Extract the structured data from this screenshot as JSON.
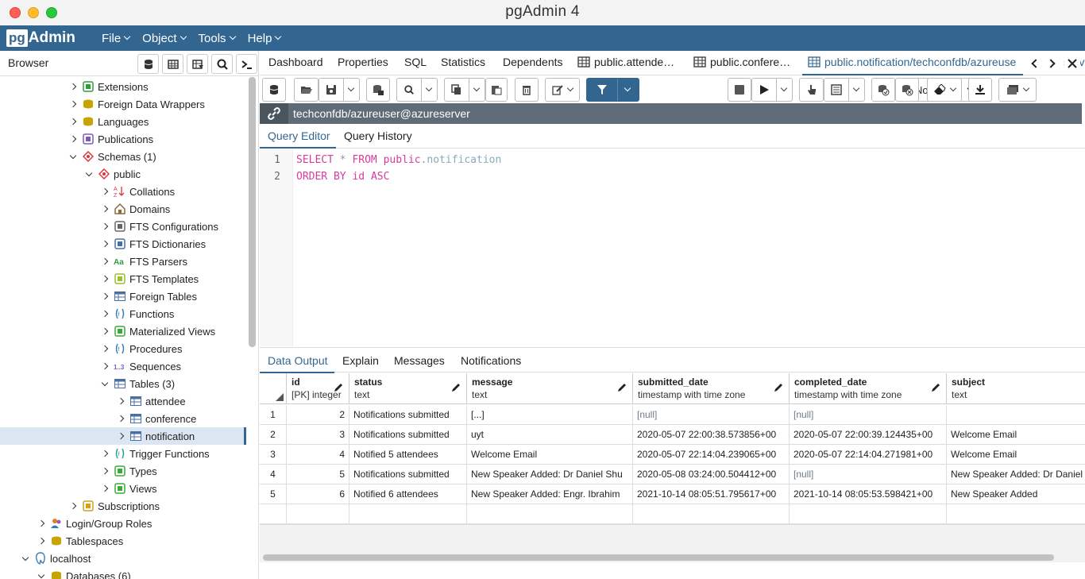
{
  "window": {
    "title": "pgAdmin 4"
  },
  "app": {
    "logo_pg": "pg",
    "logo_admin": "Admin"
  },
  "menubar": {
    "items": [
      "File",
      "Object",
      "Tools",
      "Help"
    ]
  },
  "browser": {
    "title": "Browser",
    "tree": [
      {
        "label": "Extensions",
        "indent": 1,
        "icon": "extensions-icon"
      },
      {
        "label": "Foreign Data Wrappers",
        "indent": 1,
        "icon": "foreign-data-wrapper-icon"
      },
      {
        "label": "Languages",
        "indent": 1,
        "icon": "languages-icon"
      },
      {
        "label": "Publications",
        "indent": 1,
        "icon": "publications-icon"
      },
      {
        "label": "Schemas (1)",
        "indent": 1,
        "icon": "schemas-icon",
        "open": true
      },
      {
        "label": "public",
        "indent": 2,
        "icon": "schema-icon",
        "open": true
      },
      {
        "label": "Collations",
        "indent": 3,
        "icon": "collations-icon"
      },
      {
        "label": "Domains",
        "indent": 3,
        "icon": "domains-icon"
      },
      {
        "label": "FTS Configurations",
        "indent": 3,
        "icon": "fts-config-icon"
      },
      {
        "label": "FTS Dictionaries",
        "indent": 3,
        "icon": "fts-dictionary-icon"
      },
      {
        "label": "FTS Parsers",
        "indent": 3,
        "icon": "fts-parser-icon"
      },
      {
        "label": "FTS Templates",
        "indent": 3,
        "icon": "fts-template-icon"
      },
      {
        "label": "Foreign Tables",
        "indent": 3,
        "icon": "foreign-table-icon"
      },
      {
        "label": "Functions",
        "indent": 3,
        "icon": "functions-icon"
      },
      {
        "label": "Materialized Views",
        "indent": 3,
        "icon": "materialized-view-icon"
      },
      {
        "label": "Procedures",
        "indent": 3,
        "icon": "procedures-icon"
      },
      {
        "label": "Sequences",
        "indent": 3,
        "icon": "sequences-icon"
      },
      {
        "label": "Tables (3)",
        "indent": 3,
        "icon": "tables-icon",
        "open": true
      },
      {
        "label": "attendee",
        "indent": 4,
        "icon": "table-icon"
      },
      {
        "label": "conference",
        "indent": 4,
        "icon": "table-icon"
      },
      {
        "label": "notification",
        "indent": 4,
        "icon": "table-icon",
        "selected": true
      },
      {
        "label": "Trigger Functions",
        "indent": 3,
        "icon": "trigger-function-icon"
      },
      {
        "label": "Types",
        "indent": 3,
        "icon": "types-icon"
      },
      {
        "label": "Views",
        "indent": 3,
        "icon": "views-icon"
      },
      {
        "label": "Subscriptions",
        "indent": 1,
        "icon": "subscriptions-icon"
      },
      {
        "label": "Login/Group Roles",
        "indent": -1,
        "icon": "login-roles-icon"
      },
      {
        "label": "Tablespaces",
        "indent": -1,
        "icon": "tablespaces-icon"
      },
      {
        "label": "localhost",
        "indent": -2,
        "icon": "server-icon",
        "open": true
      },
      {
        "label": "Databases (6)",
        "indent": -1,
        "icon": "databases-icon",
        "open": true
      }
    ]
  },
  "tabs": [
    {
      "label": "Dashboard"
    },
    {
      "label": "Properties"
    },
    {
      "label": "SQL"
    },
    {
      "label": "Statistics"
    },
    {
      "label": "Dependents"
    },
    {
      "label": "public.attende…"
    },
    {
      "label": "public.confere…"
    },
    {
      "label": "public.notification/techconfdb/azureuse"
    },
    {
      "label": "serv"
    }
  ],
  "toolbar": {
    "limit_value": "No limit"
  },
  "connection": {
    "label": "techconfdb/azureuser@azureserver"
  },
  "editor_tabs": [
    "Query Editor",
    "Query History"
  ],
  "editor": {
    "line_numbers": [
      "1",
      "2"
    ],
    "line1": {
      "kw1": "SELECT",
      "star": " * ",
      "kw2": "FROM",
      "schema": " public",
      "dot": ".",
      "table": "notification"
    },
    "line2": {
      "kw1": "ORDER BY",
      "col": " id ",
      "kw2": "ASC"
    }
  },
  "output_tabs": [
    "Data Output",
    "Explain",
    "Messages",
    "Notifications"
  ],
  "grid": {
    "columns": [
      {
        "name": "id",
        "type": "[PK] integer"
      },
      {
        "name": "status",
        "type": "text"
      },
      {
        "name": "message",
        "type": "text"
      },
      {
        "name": "submitted_date",
        "type": "timestamp with time zone"
      },
      {
        "name": "completed_date",
        "type": "timestamp with time zone"
      },
      {
        "name": "subject",
        "type": "text"
      }
    ],
    "rows": [
      {
        "n": "1",
        "id": "2",
        "status": "Notifications submitted",
        "message": "[...]",
        "submitted": "[null]",
        "completed": "[null]",
        "subject": ""
      },
      {
        "n": "2",
        "id": "3",
        "status": "Notifications submitted",
        "message": "uyt",
        "submitted": "2020-05-07 22:00:38.573856+00",
        "completed": "2020-05-07 22:00:39.124435+00",
        "subject": "Welcome Email"
      },
      {
        "n": "3",
        "id": "4",
        "status": "Notified 5 attendees",
        "message": "Welcome Email",
        "submitted": "2020-05-07 22:14:04.239065+00",
        "completed": "2020-05-07 22:14:04.271981+00",
        "subject": "Welcome Email"
      },
      {
        "n": "4",
        "id": "5",
        "status": "Notifications submitted",
        "message": "New Speaker Added: Dr Daniel Shu",
        "submitted": "2020-05-08 03:24:00.504412+00",
        "completed": "[null]",
        "subject": "New Speaker Added: Dr Daniel S"
      },
      {
        "n": "5",
        "id": "6",
        "status": "Notified 6 attendees",
        "message": "New Speaker Added: Engr. Ibrahim",
        "submitted": "2021-10-14 08:05:51.795617+00",
        "completed": "2021-10-14 08:05:53.598421+00",
        "subject": "New Speaker Added"
      }
    ]
  },
  "colors": {
    "brand": "#326690",
    "selected_row": "#dbe6f2",
    "keyword": "#d63b9d",
    "null_text": "#6c7a89"
  }
}
